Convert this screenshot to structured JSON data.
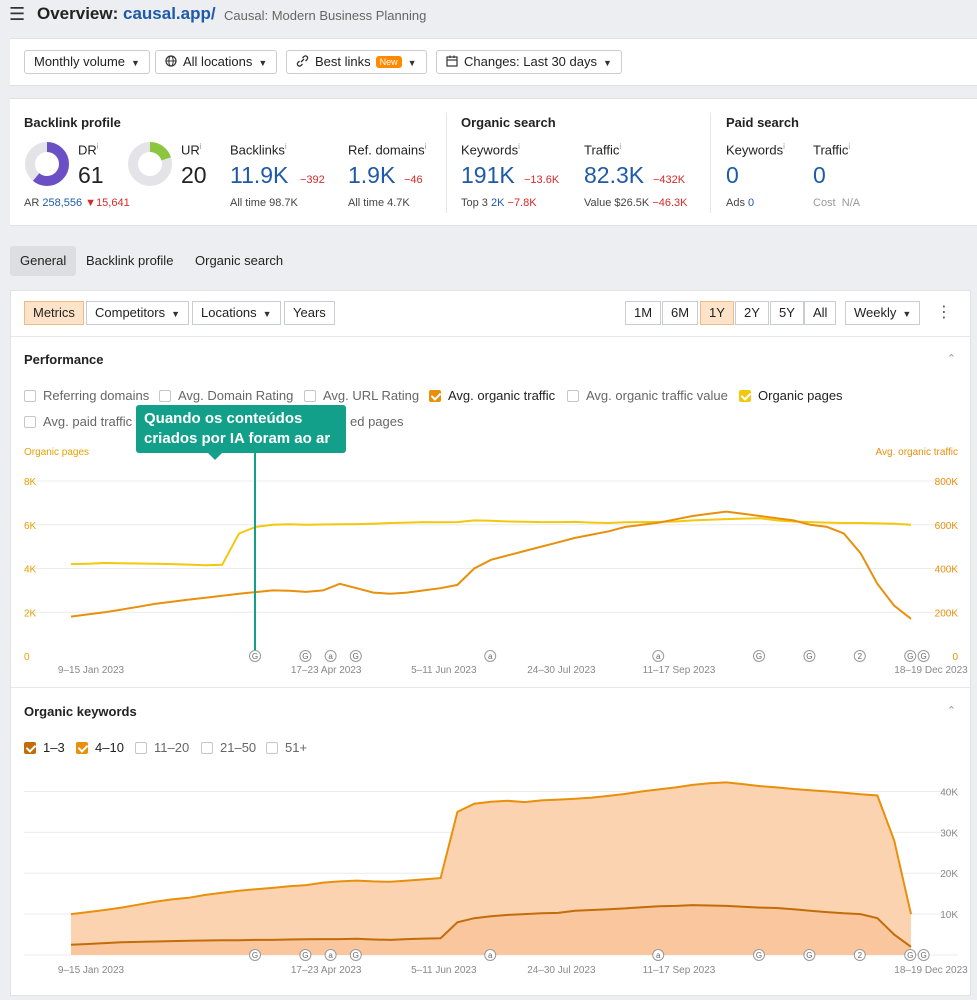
{
  "header": {
    "title_prefix": "Overview: ",
    "title_domain": "causal.app/",
    "subtitle": "Causal: Modern Business Planning"
  },
  "filters": {
    "volume": "Monthly volume",
    "locations": "All locations",
    "best_links": "Best links",
    "new_badge": "New",
    "changes": "Changes: Last 30 days"
  },
  "backlink_profile": {
    "title": "Backlink profile",
    "dr_label": "DR",
    "dr_value": "61",
    "dr_fraction": 0.61,
    "ur_label": "UR",
    "ur_value": "20",
    "ur_fraction": 0.2,
    "ar_label": "AR",
    "ar_value": "258,556",
    "ar_delta": "15,641",
    "backlinks_label": "Backlinks",
    "backlinks_value": "11.9K",
    "backlinks_delta": "−392",
    "backlinks_alltime_label": "All time",
    "backlinks_alltime": "98.7K",
    "refdomains_label": "Ref. domains",
    "refdomains_value": "1.9K",
    "refdomains_delta": "−46",
    "refdomains_alltime_label": "All time",
    "refdomains_alltime": "4.7K"
  },
  "organic_search": {
    "title": "Organic search",
    "keywords_label": "Keywords",
    "keywords_value": "191K",
    "keywords_delta": "−13.6K",
    "top3_label": "Top 3",
    "top3_value": "2K",
    "top3_delta": "−7.8K",
    "traffic_label": "Traffic",
    "traffic_value": "82.3K",
    "traffic_delta": "−432K",
    "value_label": "Value",
    "value_value": "$26.5K",
    "value_delta": "−46.3K"
  },
  "paid_search": {
    "title": "Paid search",
    "keywords_label": "Keywords",
    "keywords_value": "0",
    "ads_label": "Ads",
    "ads_value": "0",
    "traffic_label": "Traffic",
    "traffic_value": "0",
    "cost_label": "Cost",
    "cost_value": "N/A"
  },
  "tabs": [
    "General",
    "Backlink profile",
    "Organic search"
  ],
  "toolbar": {
    "metrics": "Metrics",
    "competitors": "Competitors",
    "locations": "Locations",
    "years": "Years",
    "ranges": [
      "1M",
      "6M",
      "1Y",
      "2Y",
      "5Y",
      "All"
    ],
    "active_range": "1Y",
    "interval": "Weekly"
  },
  "performance": {
    "title": "Performance",
    "checkboxes": [
      {
        "label": "Referring domains",
        "checked": false
      },
      {
        "label": "Avg. Domain Rating",
        "checked": false
      },
      {
        "label": "Avg. URL Rating",
        "checked": false
      },
      {
        "label": "Avg. organic traffic",
        "checked": true,
        "color": "#e8900c"
      },
      {
        "label": "Avg. organic traffic value",
        "checked": false
      },
      {
        "label": "Organic pages",
        "checked": true,
        "color": "#f2c80f"
      },
      {
        "label": "Avg. paid traffic",
        "checked": false
      },
      {
        "label": "ed pages",
        "checked": false
      }
    ],
    "annotation": "Quando os conteúdos criados por IA foram ao ar"
  },
  "organic_keywords": {
    "title": "Organic keywords",
    "checkboxes": [
      {
        "label": "1–3",
        "checked": true
      },
      {
        "label": "4–10",
        "checked": true
      },
      {
        "label": "11–20",
        "checked": false
      },
      {
        "label": "21–50",
        "checked": false
      },
      {
        "label": "51+",
        "checked": false
      }
    ]
  },
  "chart_data": [
    {
      "type": "line",
      "title": "Performance",
      "y_left_label": "Organic pages",
      "y_right_label": "Avg. organic traffic",
      "y_left_ticks": [
        "0",
        "2K",
        "4K",
        "6K",
        "8K"
      ],
      "y_right_ticks": [
        "0",
        "200K",
        "400K",
        "600K",
        "800K"
      ],
      "ylim_left": [
        0,
        8000
      ],
      "ylim_right": [
        0,
        800000
      ],
      "x_tick_labels": [
        "9–15 Jan 2023",
        "17–23 Apr 2023",
        "5–11 Jun 2023",
        "24–30 Jul 2023",
        "11–17 Sep 2023",
        "18–19 Dec 2023"
      ],
      "x_tick_weeks": [
        0,
        14,
        21,
        28,
        35,
        50
      ],
      "weeks": 51,
      "series": [
        {
          "name": "Organic pages",
          "axis": "left",
          "color": "#f2c80f",
          "values": [
            4200,
            4220,
            4250,
            4240,
            4230,
            4220,
            4200,
            4180,
            4150,
            4170,
            5600,
            5900,
            6000,
            6020,
            6000,
            6010,
            6020,
            6030,
            6050,
            6080,
            6100,
            6120,
            6110,
            6120,
            6200,
            6180,
            6150,
            6140,
            6120,
            6120,
            6130,
            6100,
            6080,
            6110,
            6120,
            6130,
            6150,
            6200,
            6230,
            6260,
            6280,
            6300,
            6200,
            6150,
            6120,
            6100,
            6080,
            6080,
            6060,
            6050,
            6000
          ]
        },
        {
          "name": "Avg. organic traffic",
          "axis": "right",
          "color": "#e8900c",
          "values": [
            180000,
            190000,
            200000,
            212000,
            225000,
            238000,
            248000,
            258000,
            266000,
            275000,
            285000,
            292000,
            300000,
            298000,
            293000,
            300000,
            330000,
            310000,
            290000,
            285000,
            290000,
            300000,
            310000,
            325000,
            400000,
            440000,
            460000,
            480000,
            500000,
            520000,
            540000,
            555000,
            570000,
            590000,
            600000,
            610000,
            625000,
            640000,
            650000,
            660000,
            650000,
            640000,
            630000,
            620000,
            600000,
            590000,
            560000,
            470000,
            330000,
            230000,
            170000
          ]
        }
      ]
    },
    {
      "type": "area",
      "title": "Organic keywords",
      "y_ticks": [
        "10K",
        "20K",
        "30K",
        "40K"
      ],
      "ylim": [
        0,
        45000
      ],
      "x_tick_labels": [
        "9–15 Jan 2023",
        "17–23 Apr 2023",
        "5–11 Jun 2023",
        "24–30 Jul 2023",
        "11–17 Sep 2023",
        "18–19 Dec 2023"
      ],
      "x_tick_weeks": [
        0,
        14,
        21,
        28,
        35,
        50
      ],
      "weeks": 51,
      "series": [
        {
          "name": "4–10",
          "color": "#f5b078",
          "values": [
            10000,
            10500,
            11000,
            11600,
            12300,
            13000,
            13600,
            14000,
            14700,
            15200,
            15700,
            16100,
            16400,
            16800,
            17100,
            17700,
            18000,
            18200,
            18000,
            17900,
            18200,
            18500,
            18800,
            35000,
            37000,
            37500,
            37700,
            37400,
            37800,
            38000,
            38200,
            38500,
            38900,
            39400,
            40000,
            40500,
            41000,
            41600,
            42000,
            42200,
            41800,
            41300,
            41000,
            40600,
            40300,
            40000,
            39700,
            39300,
            39000,
            28000,
            10000
          ]
        },
        {
          "name": "1–3",
          "color": "#e8900c",
          "values": [
            2500,
            2700,
            2900,
            3100,
            3200,
            3300,
            3400,
            3500,
            3550,
            3600,
            3600,
            3700,
            3700,
            3800,
            3850,
            3900,
            3900,
            3950,
            3800,
            3700,
            3900,
            4000,
            4100,
            8000,
            9000,
            9500,
            9800,
            10000,
            10200,
            10300,
            10800,
            11000,
            11200,
            11400,
            11700,
            11900,
            12000,
            12200,
            12100,
            12000,
            11800,
            11600,
            11500,
            11200,
            10800,
            10500,
            10200,
            10000,
            9000,
            5000,
            2000
          ]
        }
      ]
    }
  ]
}
